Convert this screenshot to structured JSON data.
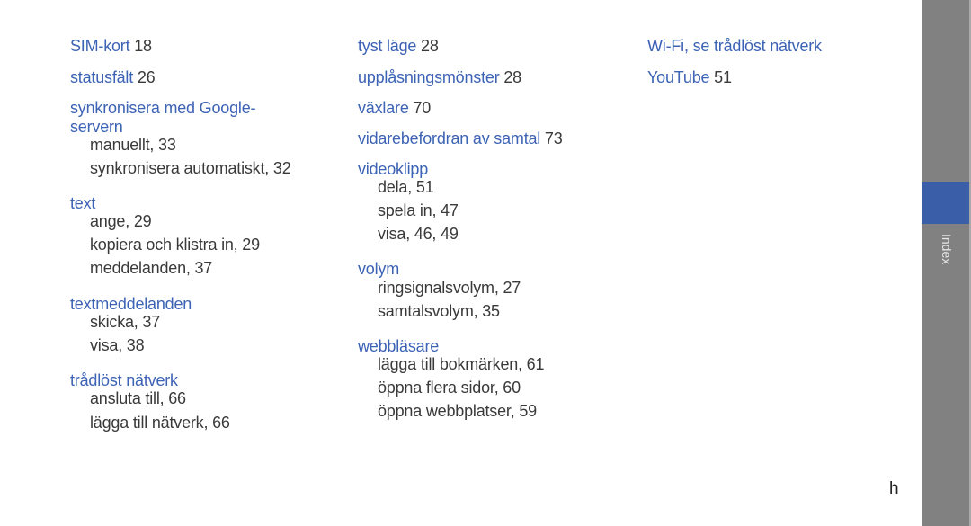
{
  "columns": [
    {
      "entries": [
        {
          "term": "SIM-kort",
          "page": "18"
        },
        {
          "term": "statusfält",
          "page": "26"
        },
        {
          "term": "synkronisera med Google-",
          "term2": "servern",
          "subs": [
            "manuellt, 33",
            "synkronisera automatiskt, 32"
          ]
        },
        {
          "term": "text",
          "subs": [
            "ange, 29",
            "kopiera och klistra in, 29",
            "meddelanden, 37"
          ]
        },
        {
          "term": "textmeddelanden",
          "subs": [
            "skicka, 37",
            "visa, 38"
          ]
        },
        {
          "term": "trådlöst nätverk",
          "subs": [
            "ansluta till, 66",
            "lägga till nätverk, 66"
          ]
        }
      ]
    },
    {
      "entries": [
        {
          "term": "tyst läge",
          "page": "28"
        },
        {
          "term": "upplåsningsmönster",
          "page": "28"
        },
        {
          "term": "växlare",
          "page": "70"
        },
        {
          "term": "vidarebefordran av samtal",
          "page": "73"
        },
        {
          "term": "videoklipp",
          "subs": [
            "dela, 51",
            "spela in, 47",
            "visa, 46, 49"
          ]
        },
        {
          "term": "volym",
          "subs": [
            "ringsignalsvolym, 27",
            "samtalsvolym, 35"
          ]
        },
        {
          "term": "webbläsare",
          "subs": [
            "lägga till bokmärken, 61",
            "öppna flera sidor, 60",
            "öppna webbplatser, 59"
          ]
        }
      ]
    },
    {
      "entries": [
        {
          "term": "Wi-Fi, se trådlöst nätverk"
        },
        {
          "term": "YouTube",
          "page": "51"
        }
      ]
    }
  ],
  "sidebar": {
    "tab_label": "Index",
    "tab_color": "#3b5ea9"
  },
  "page_letter": "h",
  "colors": {
    "link": "#3d63b5",
    "text": "#3a3a3a",
    "sidebar": "#818181"
  }
}
